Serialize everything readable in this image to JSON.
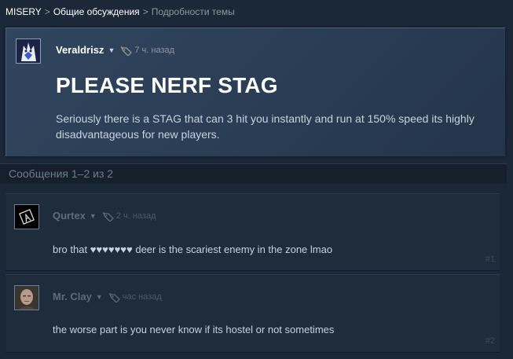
{
  "breadcrumb": {
    "game": "MISERY",
    "forum": "Общие обсуждения",
    "current": "Подробности темы",
    "separator": ">"
  },
  "topic": {
    "author": "Veraldrisz",
    "time": "7 ч. назад",
    "title": "PLEASE NERF STAG",
    "body": "Seriously there is a STAG that can 3 hit you instantly and run at 150% speed its highly disadvantageous for new players."
  },
  "messages_count": "Сообщения 1–2 из 2",
  "comments": [
    {
      "author": "Qurtex",
      "time": "2 ч. назад",
      "text": "bro that ♥♥♥♥♥♥♥ deer is the scariest enemy in the zone lmao",
      "num": "#1"
    },
    {
      "author": "Mr. Clay",
      "time": "час назад",
      "text": "the worse part is you never know if its hostel or not sometimes",
      "num": "#2"
    }
  ],
  "icons": {
    "caret": "dropdown-caret-icon",
    "tag": "award-tag-icon"
  },
  "colors": {
    "background": "#1b2838",
    "topic_panel": "#2a3d54",
    "comment_panel": "#1e2c3c",
    "link_white": "#ffffff",
    "muted": "#8f98a0"
  }
}
